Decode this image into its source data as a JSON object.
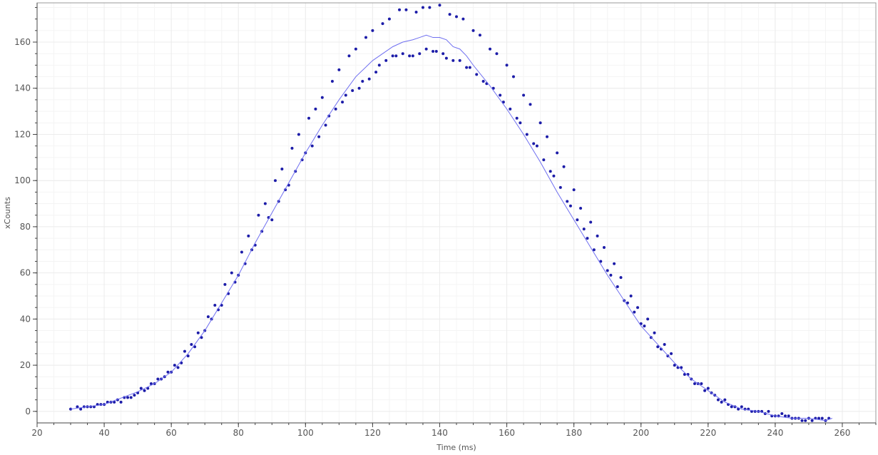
{
  "chart_data": {
    "type": "scatter",
    "title": "",
    "xlabel": "Time (ms)",
    "ylabel": "xCounts",
    "xlim": [
      20,
      270
    ],
    "ylim": [
      -5,
      177
    ],
    "x_ticks": [
      20,
      40,
      60,
      80,
      100,
      120,
      140,
      160,
      180,
      200,
      220,
      240,
      260
    ],
    "y_ticks": [
      0,
      20,
      40,
      60,
      80,
      100,
      120,
      140,
      160
    ],
    "grid": true,
    "legend": "none",
    "colors": {
      "points": "#1c1ca8",
      "line": "#6f6ff0",
      "grid": "#ececec",
      "axis": "#444444",
      "text": "#555555"
    },
    "series": [
      {
        "type": "scatter",
        "points": [
          [
            30,
            1
          ],
          [
            32,
            2
          ],
          [
            33,
            1
          ],
          [
            34,
            2
          ],
          [
            35,
            2
          ],
          [
            36,
            2
          ],
          [
            37,
            2
          ],
          [
            38,
            3
          ],
          [
            39,
            3
          ],
          [
            40,
            3
          ],
          [
            41,
            4
          ],
          [
            42,
            4
          ],
          [
            43,
            4
          ],
          [
            44,
            5
          ],
          [
            45,
            4
          ],
          [
            46,
            6
          ],
          [
            47,
            6
          ],
          [
            48,
            6
          ],
          [
            49,
            7
          ],
          [
            50,
            8
          ],
          [
            51,
            10
          ],
          [
            52,
            9
          ],
          [
            53,
            10
          ],
          [
            54,
            12
          ],
          [
            55,
            12
          ],
          [
            56,
            14
          ],
          [
            57,
            14
          ],
          [
            58,
            15
          ],
          [
            59,
            17
          ],
          [
            60,
            17
          ],
          [
            61,
            20
          ],
          [
            62,
            19
          ],
          [
            63,
            21
          ],
          [
            64,
            26
          ],
          [
            65,
            24
          ],
          [
            66,
            29
          ],
          [
            67,
            28
          ],
          [
            68,
            34
          ],
          [
            69,
            32
          ],
          [
            70,
            35
          ],
          [
            71,
            41
          ],
          [
            72,
            40
          ],
          [
            73,
            46
          ],
          [
            74,
            44
          ],
          [
            75,
            46
          ],
          [
            76,
            55
          ],
          [
            77,
            51
          ],
          [
            78,
            60
          ],
          [
            79,
            56
          ],
          [
            80,
            59
          ],
          [
            81,
            69
          ],
          [
            82,
            64
          ],
          [
            83,
            76
          ],
          [
            84,
            70
          ],
          [
            85,
            72
          ],
          [
            86,
            85
          ],
          [
            87,
            78
          ],
          [
            88,
            90
          ],
          [
            89,
            84
          ],
          [
            90,
            83
          ],
          [
            91,
            100
          ],
          [
            92,
            91
          ],
          [
            93,
            105
          ],
          [
            94,
            96
          ],
          [
            95,
            98
          ],
          [
            96,
            114
          ],
          [
            97,
            104
          ],
          [
            98,
            120
          ],
          [
            99,
            109
          ],
          [
            100,
            112
          ],
          [
            101,
            127
          ],
          [
            102,
            115
          ],
          [
            103,
            131
          ],
          [
            104,
            119
          ],
          [
            105,
            136
          ],
          [
            106,
            124
          ],
          [
            107,
            128
          ],
          [
            108,
            143
          ],
          [
            109,
            131
          ],
          [
            110,
            148
          ],
          [
            111,
            134
          ],
          [
            112,
            137
          ],
          [
            113,
            154
          ],
          [
            114,
            139
          ],
          [
            115,
            157
          ],
          [
            116,
            140
          ],
          [
            117,
            143
          ],
          [
            118,
            162
          ],
          [
            119,
            144
          ],
          [
            120,
            165
          ],
          [
            121,
            147
          ],
          [
            122,
            150
          ],
          [
            123,
            168
          ],
          [
            124,
            152
          ],
          [
            125,
            170
          ],
          [
            126,
            154
          ],
          [
            127,
            154
          ],
          [
            128,
            174
          ],
          [
            129,
            155
          ],
          [
            130,
            174
          ],
          [
            131,
            154
          ],
          [
            132,
            154
          ],
          [
            133,
            173
          ],
          [
            134,
            155
          ],
          [
            135,
            175
          ],
          [
            136,
            157
          ],
          [
            137,
            175
          ],
          [
            138,
            156
          ],
          [
            139,
            156
          ],
          [
            140,
            176
          ],
          [
            141,
            155
          ],
          [
            142,
            153
          ],
          [
            143,
            172
          ],
          [
            144,
            152
          ],
          [
            145,
            171
          ],
          [
            146,
            152
          ],
          [
            147,
            170
          ],
          [
            148,
            149
          ],
          [
            149,
            149
          ],
          [
            150,
            165
          ],
          [
            151,
            146
          ],
          [
            152,
            163
          ],
          [
            153,
            143
          ],
          [
            154,
            142
          ],
          [
            155,
            157
          ],
          [
            156,
            140
          ],
          [
            157,
            155
          ],
          [
            158,
            137
          ],
          [
            159,
            134
          ],
          [
            160,
            150
          ],
          [
            161,
            131
          ],
          [
            162,
            145
          ],
          [
            163,
            127
          ],
          [
            164,
            125
          ],
          [
            165,
            137
          ],
          [
            166,
            120
          ],
          [
            167,
            133
          ],
          [
            168,
            116
          ],
          [
            169,
            115
          ],
          [
            170,
            125
          ],
          [
            171,
            109
          ],
          [
            172,
            119
          ],
          [
            173,
            104
          ],
          [
            174,
            102
          ],
          [
            175,
            112
          ],
          [
            176,
            97
          ],
          [
            177,
            106
          ],
          [
            178,
            91
          ],
          [
            179,
            89
          ],
          [
            180,
            96
          ],
          [
            181,
            83
          ],
          [
            182,
            88
          ],
          [
            183,
            79
          ],
          [
            184,
            75
          ],
          [
            185,
            82
          ],
          [
            186,
            70
          ],
          [
            187,
            76
          ],
          [
            188,
            65
          ],
          [
            189,
            71
          ],
          [
            190,
            61
          ],
          [
            191,
            59
          ],
          [
            192,
            64
          ],
          [
            193,
            54
          ],
          [
            194,
            58
          ],
          [
            195,
            48
          ],
          [
            196,
            47
          ],
          [
            197,
            50
          ],
          [
            198,
            43
          ],
          [
            199,
            45
          ],
          [
            200,
            38
          ],
          [
            201,
            37
          ],
          [
            202,
            40
          ],
          [
            203,
            32
          ],
          [
            204,
            34
          ],
          [
            205,
            28
          ],
          [
            206,
            27
          ],
          [
            207,
            29
          ],
          [
            208,
            24
          ],
          [
            209,
            25
          ],
          [
            210,
            20
          ],
          [
            211,
            19
          ],
          [
            212,
            19
          ],
          [
            213,
            16
          ],
          [
            214,
            16
          ],
          [
            215,
            14
          ],
          [
            216,
            12
          ],
          [
            217,
            12
          ],
          [
            218,
            12
          ],
          [
            219,
            9
          ],
          [
            220,
            10
          ],
          [
            221,
            8
          ],
          [
            222,
            7
          ],
          [
            223,
            5
          ],
          [
            224,
            4
          ],
          [
            225,
            5
          ],
          [
            226,
            3
          ],
          [
            227,
            2
          ],
          [
            228,
            2
          ],
          [
            229,
            1
          ],
          [
            230,
            2
          ],
          [
            231,
            1
          ],
          [
            232,
            1
          ],
          [
            233,
            0
          ],
          [
            234,
            0
          ],
          [
            235,
            0
          ],
          [
            236,
            0
          ],
          [
            237,
            -1
          ],
          [
            238,
            0
          ],
          [
            239,
            -2
          ],
          [
            240,
            -2
          ],
          [
            241,
            -2
          ],
          [
            242,
            -1
          ],
          [
            243,
            -2
          ],
          [
            244,
            -2
          ],
          [
            245,
            -3
          ],
          [
            246,
            -3
          ],
          [
            247,
            -3
          ],
          [
            248,
            -4
          ],
          [
            249,
            -4
          ],
          [
            250,
            -3
          ],
          [
            251,
            -4
          ],
          [
            252,
            -3
          ],
          [
            253,
            -3
          ],
          [
            254,
            -3
          ],
          [
            255,
            -4
          ],
          [
            256,
            -3
          ]
        ]
      },
      {
        "type": "line",
        "points": [
          [
            30,
            1
          ],
          [
            40,
            3
          ],
          [
            50,
            8.5
          ],
          [
            55,
            12
          ],
          [
            60,
            17
          ],
          [
            65,
            25
          ],
          [
            70,
            35
          ],
          [
            75,
            47
          ],
          [
            80,
            59
          ],
          [
            85,
            73
          ],
          [
            90,
            86
          ],
          [
            95,
            99
          ],
          [
            100,
            112
          ],
          [
            105,
            124
          ],
          [
            110,
            135
          ],
          [
            115,
            145
          ],
          [
            120,
            152
          ],
          [
            123,
            155
          ],
          [
            126,
            158
          ],
          [
            129,
            160
          ],
          [
            132,
            161
          ],
          [
            134,
            162
          ],
          [
            136,
            163
          ],
          [
            138,
            162
          ],
          [
            140,
            162
          ],
          [
            142,
            161
          ],
          [
            144,
            158
          ],
          [
            146,
            157
          ],
          [
            148,
            154
          ],
          [
            150,
            150
          ],
          [
            155,
            141
          ],
          [
            160,
            131
          ],
          [
            165,
            120
          ],
          [
            170,
            108
          ],
          [
            175,
            95
          ],
          [
            180,
            83
          ],
          [
            185,
            71
          ],
          [
            190,
            59
          ],
          [
            195,
            48
          ],
          [
            200,
            37
          ],
          [
            205,
            29
          ],
          [
            210,
            21
          ],
          [
            215,
            14
          ],
          [
            220,
            9
          ],
          [
            225,
            4
          ],
          [
            230,
            1
          ],
          [
            235,
            0
          ],
          [
            240,
            -2
          ],
          [
            245,
            -3
          ],
          [
            250,
            -3
          ],
          [
            255,
            -4
          ],
          [
            257,
            -3
          ]
        ]
      }
    ]
  }
}
